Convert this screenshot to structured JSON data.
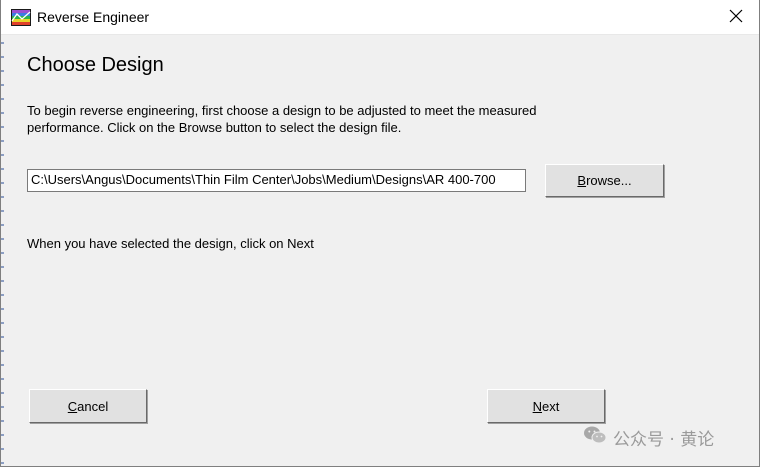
{
  "window": {
    "title": "Reverse Engineer",
    "close_symbol": "✕"
  },
  "page": {
    "heading": "Choose Design",
    "instructions": "To begin reverse engineering, first choose a design to be adjusted to meet the measured performance. Click on the Browse button to select the design file.",
    "design_path": "C:\\Users\\Angus\\Documents\\Thin Film Center\\Jobs\\Medium\\Designs\\AR 400-700",
    "hint": "When you have selected the design, click on Next"
  },
  "buttons": {
    "browse": {
      "accel": "B",
      "rest": "rowse..."
    },
    "cancel": {
      "accel": "C",
      "rest": "ancel"
    },
    "next": {
      "accel": "N",
      "rest": "ext"
    }
  },
  "watermark": {
    "text": "公众号 · 黄论"
  },
  "icons": {
    "app": "app-logo-icon",
    "close": "close-icon",
    "watermark": "wechat-icon"
  }
}
